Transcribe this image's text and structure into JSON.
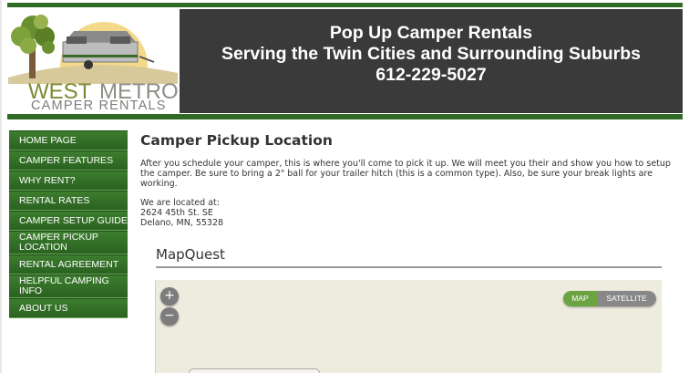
{
  "logo": {
    "word_west": "WEST",
    "word_metro": "METRO",
    "subtitle": "CAMPER RENTALS"
  },
  "header": {
    "line1": "Pop Up Camper Rentals",
    "line2": "Serving the Twin Cities and Surrounding Suburbs",
    "phone": "612-229-5027"
  },
  "sidebar": {
    "items": [
      {
        "label": "HOME PAGE"
      },
      {
        "label": "CAMPER FEATURES"
      },
      {
        "label": "WHY RENT?"
      },
      {
        "label": "RENTAL RATES"
      },
      {
        "label": "CAMPER SETUP GUIDE"
      },
      {
        "label": "CAMPER PICKUP LOCATION"
      },
      {
        "label": "RENTAL AGREEMENT"
      },
      {
        "label": "HELPFUL CAMPING INFO"
      },
      {
        "label": "ABOUT US"
      }
    ]
  },
  "main": {
    "title": "Camper Pickup Location",
    "paragraph": "After you schedule your camper, this is where you'll come to pick it up.  We will meet you their and show you how to setup the camper.  Be sure to bring a 2\" ball for your trailer hitch (this is a common type).  Also, be sure your break lights are working.",
    "located_label": "We are located at:",
    "address_street": "2624 45th St. SE",
    "address_city": "Delano, MN, 55328"
  },
  "map": {
    "heading": "MapQuest",
    "zoom_in": "+",
    "zoom_out": "−",
    "toggle_map": "MAP",
    "toggle_satellite": "SATELLITE"
  },
  "colors": {
    "brand_green": "#2f6b24",
    "header_dark": "#3a3a3a",
    "map_active": "#6aa33f"
  }
}
